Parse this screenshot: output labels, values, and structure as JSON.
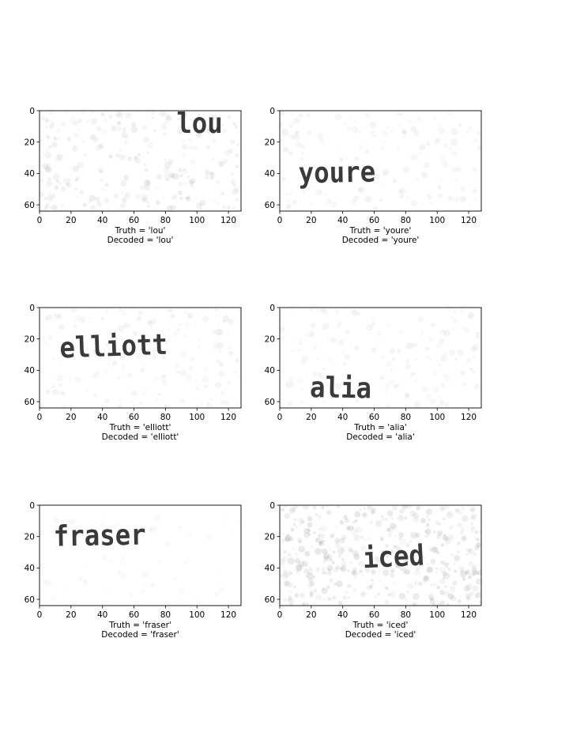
{
  "chart_data": [
    {
      "type": "image",
      "word": "lou",
      "caption_truth": "Truth = 'lou'",
      "caption_decoded": "Decoded = 'lou'",
      "xlim": [
        0,
        128
      ],
      "ylim": [
        64,
        0
      ],
      "xticks": [
        0,
        20,
        40,
        60,
        80,
        100,
        120
      ],
      "yticks": [
        0,
        20,
        40,
        60
      ],
      "word_pos": [
        87,
        14
      ],
      "word_rot": 0,
      "noise_level": "medium"
    },
    {
      "type": "image",
      "word": "youre",
      "caption_truth": "Truth = 'youre'",
      "caption_decoded": "Decoded = 'youre'",
      "xlim": [
        0,
        128
      ],
      "ylim": [
        64,
        0
      ],
      "xticks": [
        0,
        20,
        40,
        60,
        80,
        100,
        120
      ],
      "yticks": [
        0,
        20,
        40,
        60
      ],
      "word_pos": [
        12,
        46
      ],
      "word_rot": -1,
      "noise_level": "light"
    },
    {
      "type": "image",
      "word": "elliott",
      "caption_truth": "Truth = 'elliott'",
      "caption_decoded": "Decoded = 'elliott'",
      "xlim": [
        0,
        128
      ],
      "ylim": [
        64,
        0
      ],
      "xticks": [
        0,
        20,
        40,
        60,
        80,
        100,
        120
      ],
      "yticks": [
        0,
        20,
        40,
        60
      ],
      "word_pos": [
        13,
        32
      ],
      "word_rot": -2,
      "noise_level": "light"
    },
    {
      "type": "image",
      "word": "alia",
      "caption_truth": "Truth = 'alia'",
      "caption_decoded": "Decoded = 'alia'",
      "xlim": [
        0,
        128
      ],
      "ylim": [
        64,
        0
      ],
      "xticks": [
        0,
        20,
        40,
        60,
        80,
        100,
        120
      ],
      "yticks": [
        0,
        20,
        40,
        60
      ],
      "word_pos": [
        19,
        57
      ],
      "word_rot": 1,
      "noise_level": "light"
    },
    {
      "type": "image",
      "word": "fraser",
      "caption_truth": "Truth = 'fraser'",
      "caption_decoded": "Decoded = 'fraser'",
      "xlim": [
        0,
        128
      ],
      "ylim": [
        64,
        0
      ],
      "xticks": [
        0,
        20,
        40,
        60,
        80,
        100,
        120
      ],
      "yticks": [
        0,
        20,
        40,
        60
      ],
      "word_pos": [
        9,
        26
      ],
      "word_rot": -1,
      "noise_level": "very-light"
    },
    {
      "type": "image",
      "word": "iced",
      "caption_truth": "Truth = 'iced'",
      "caption_decoded": "Decoded = 'iced'",
      "xlim": [
        0,
        128
      ],
      "ylim": [
        64,
        0
      ],
      "xticks": [
        0,
        20,
        40,
        60,
        80,
        100,
        120
      ],
      "yticks": [
        0,
        20,
        40,
        60
      ],
      "word_pos": [
        53,
        40
      ],
      "word_rot": -3,
      "noise_level": "heavy"
    }
  ],
  "colors": {
    "axes": "#000000",
    "background": "#ffffff",
    "text_ink": "#1f1f1f",
    "noise": "#9a9a9a"
  }
}
